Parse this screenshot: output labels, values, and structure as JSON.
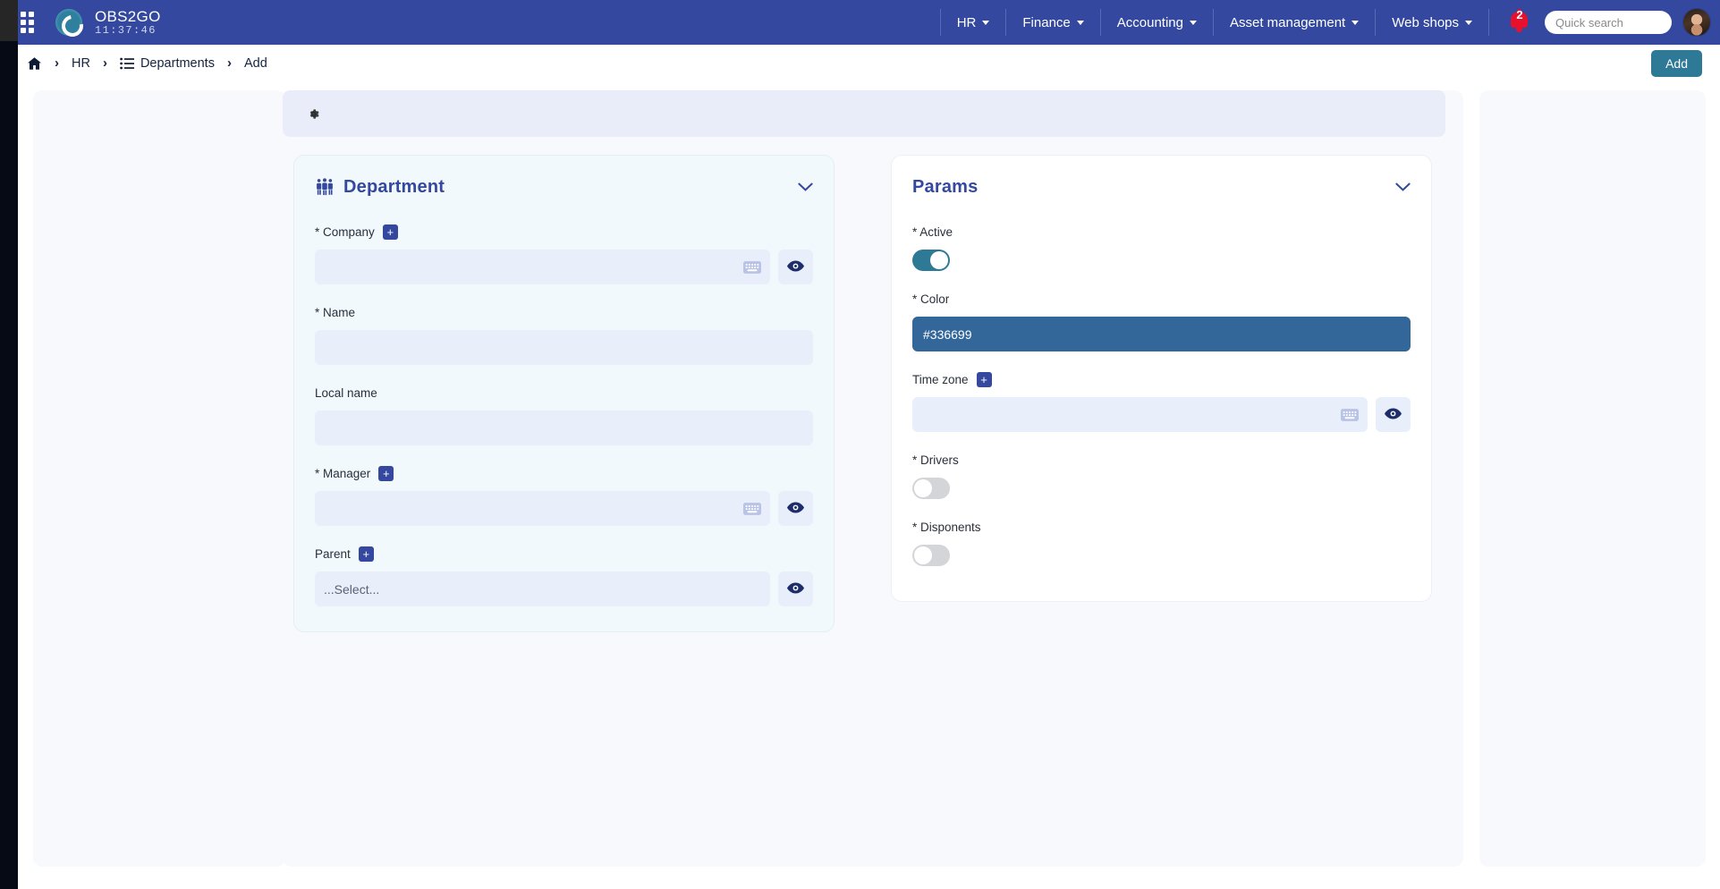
{
  "navbar": {
    "apps_icon": "grid-apps-icon",
    "brand_logo_icon": "obs2go-logo-icon",
    "brand_name": "OBS2GO",
    "clock": "11:37:46",
    "menu": [
      {
        "label": "HR"
      },
      {
        "label": "Finance"
      },
      {
        "label": "Accounting"
      },
      {
        "label": "Asset management"
      },
      {
        "label": "Web shops"
      }
    ],
    "notifications": {
      "icon": "bell-icon",
      "count": "2"
    },
    "search": {
      "placeholder": "Quick search",
      "value": ""
    },
    "avatar_icon": "user-avatar"
  },
  "breadcrumb": {
    "home_icon": "home-icon",
    "items": [
      {
        "label": "HR",
        "icon": ""
      },
      {
        "label": "Departments",
        "icon": "list-icon"
      },
      {
        "label": "Add",
        "icon": ""
      }
    ],
    "separator": "›",
    "add_button": "Add"
  },
  "toolbar": {
    "gear_icon": "gear-icon"
  },
  "department_card": {
    "icon": "people-group-icon",
    "title": "Department",
    "collapse_icon": "chevron-down-icon",
    "fields": {
      "company": {
        "label": "* Company",
        "add_icon": "plus-icon",
        "value": "",
        "keyboard_icon": "keyboard-icon",
        "view_icon": "eye-icon"
      },
      "name": {
        "label": "* Name",
        "value": ""
      },
      "local_name": {
        "label": "Local name",
        "value": ""
      },
      "manager": {
        "label": "* Manager",
        "add_icon": "plus-icon",
        "value": "",
        "keyboard_icon": "keyboard-icon",
        "view_icon": "eye-icon"
      },
      "parent": {
        "label": "Parent",
        "add_icon": "plus-icon",
        "value": "...Select...",
        "view_icon": "eye-icon"
      }
    }
  },
  "params_card": {
    "title": "Params",
    "collapse_icon": "chevron-down-icon",
    "fields": {
      "active": {
        "label": "* Active",
        "state": "on"
      },
      "color": {
        "label": "* Color",
        "value": "#336699",
        "swatch": "#336699"
      },
      "time_zone": {
        "label": "Time zone",
        "add_icon": "plus-icon",
        "value": "",
        "keyboard_icon": "keyboard-icon",
        "view_icon": "eye-icon"
      },
      "drivers": {
        "label": "* Drivers",
        "state": "off"
      },
      "disponents": {
        "label": "* Disponents",
        "state": "off"
      }
    }
  },
  "theme": {
    "nav_blue": "#33489e",
    "accent_teal": "#2d7996",
    "field_bg": "#e9eefb",
    "card_bg": "#f2f9fd",
    "danger_red": "#e8112d"
  }
}
